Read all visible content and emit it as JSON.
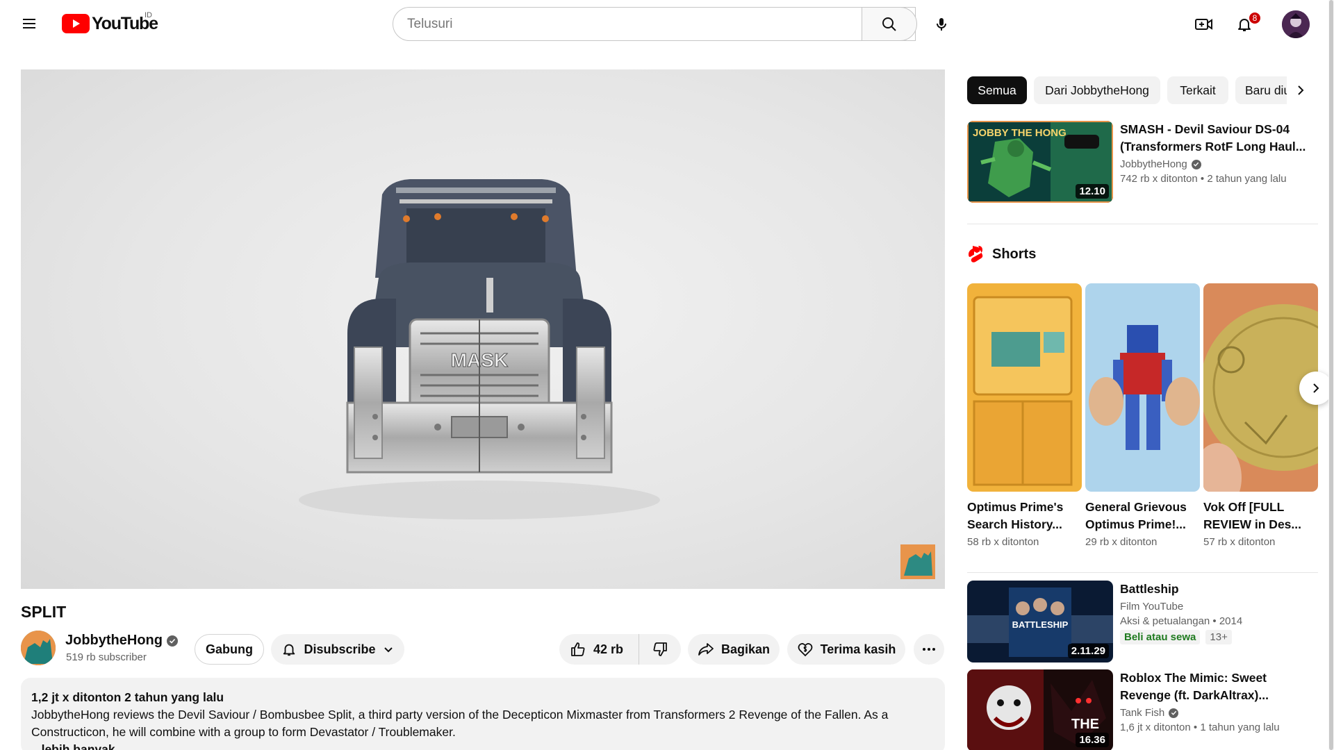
{
  "masthead": {
    "logo_text": "YouTube",
    "region": "ID",
    "search_placeholder": "Telusuri",
    "notification_count": "8"
  },
  "video": {
    "title": "SPLIT",
    "grille_text": "MASK"
  },
  "owner": {
    "channel_name": "JobbytheHong",
    "subscribers": "519 rb subscriber",
    "join_label": "Gabung",
    "subscribe_label": "Disubscribe",
    "like_count": "42 rb",
    "share_label": "Bagikan",
    "thanks_label": "Terima kasih"
  },
  "description": {
    "meta": "1,2 jt x ditonton  2 tahun yang lalu",
    "text": "JobbytheHong reviews the Devil Saviour / Bombusbee Split, a third party version of the Decepticon Mixmaster from Transformers 2 Revenge of the Fallen. As a Constructicon, he will combine with a group to form Devastator / Troublemaker.",
    "more_label": "...lebih banyak"
  },
  "chips": [
    "Semua",
    "Dari JobbytheHong",
    "Terkait",
    "Baru diupload"
  ],
  "rec1": {
    "title": "SMASH - Devil Saviour DS-04 (Transformers RotF Long Haul...",
    "channel": "JobbytheHong",
    "views": "742 rb x ditonton",
    "age": "2 tahun yang lalu",
    "duration": "12.10",
    "thumb_text": "JOBBY THE HONG"
  },
  "shorts": {
    "heading": "Shorts",
    "items": [
      {
        "title": "Optimus Prime's Search History...",
        "views": "58 rb x ditonton"
      },
      {
        "title": "General Grievous Optimus Prime!...",
        "views": "29 rb x ditonton"
      },
      {
        "title": "Vok Off [FULL REVIEW in Des...",
        "views": "57 rb x ditonton"
      }
    ]
  },
  "rec2": {
    "title": "Battleship",
    "channel": "Film YouTube",
    "genre": "Aksi & petualangan • 2014",
    "buy_label": "Beli atau sewa",
    "age_rating": "13+",
    "duration": "2.11.29",
    "thumb_text": "BATTLESHIP"
  },
  "rec3": {
    "title": "Roblox The Mimic: Sweet Revenge (ft. DarkAltrax)...",
    "channel": "Tank Fish",
    "views": "1,6 jt x ditonton",
    "age": "1 tahun yang lalu",
    "duration": "16.36",
    "thumb_text": "THE"
  },
  "colors": {
    "brand_red": "#ff0000",
    "badge_red": "#cc0000",
    "chip_active": "#0f0f0f",
    "buy_green": "#1f7a1f"
  }
}
